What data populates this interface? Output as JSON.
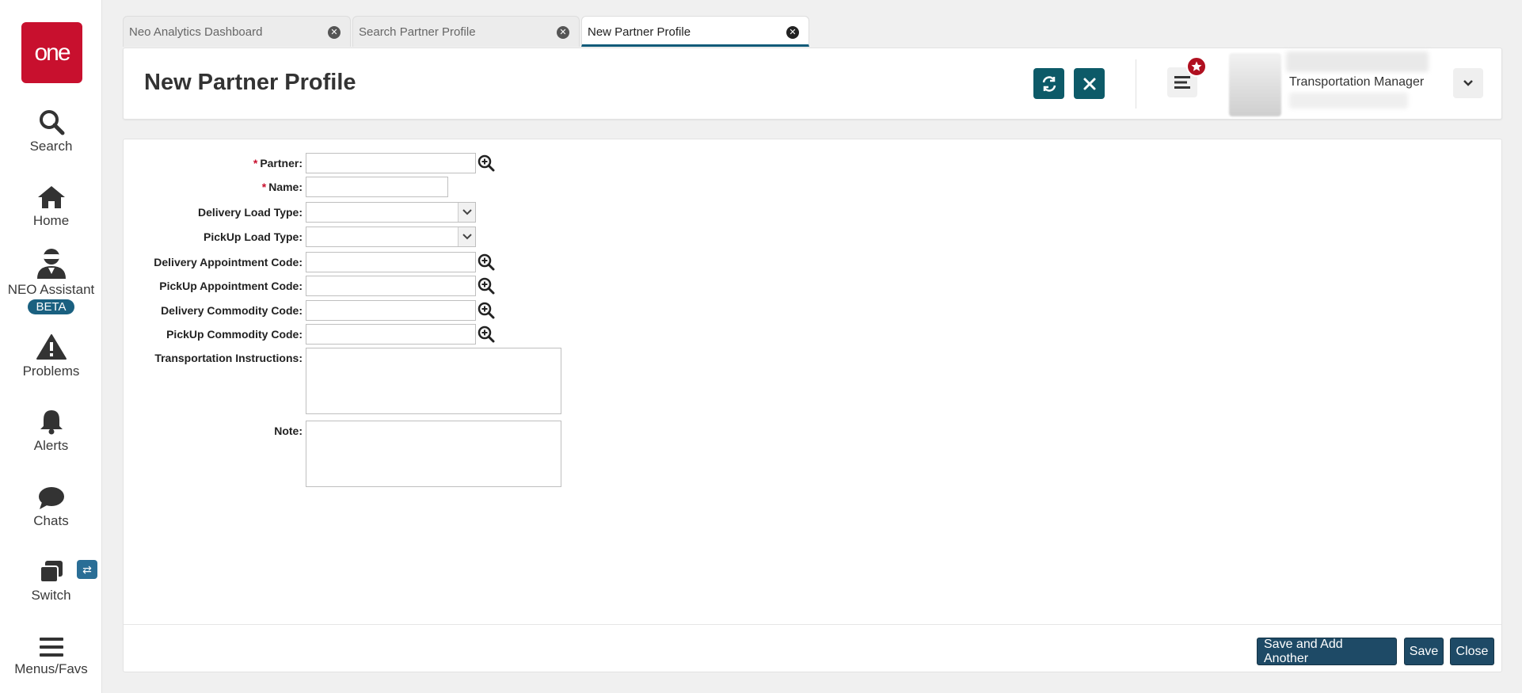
{
  "nav": {
    "logo_text": "one",
    "items": [
      {
        "key": "search",
        "label": "Search",
        "icon": "search-icon"
      },
      {
        "key": "home",
        "label": "Home",
        "icon": "home-icon"
      },
      {
        "key": "neo",
        "label": "NEO Assistant",
        "badge": "BETA",
        "icon": "neo-assistant-icon"
      },
      {
        "key": "problems",
        "label": "Problems",
        "icon": "warning-icon"
      },
      {
        "key": "alerts",
        "label": "Alerts",
        "icon": "bell-icon"
      },
      {
        "key": "chats",
        "label": "Chats",
        "icon": "chat-bubble-icon"
      },
      {
        "key": "switch",
        "label": "Switch",
        "icon": "switch-icon"
      },
      {
        "key": "menus",
        "label": "Menus/Favs",
        "icon": "hamburger-icon"
      }
    ]
  },
  "tabs": [
    {
      "label": "Neo Analytics Dashboard",
      "active": false
    },
    {
      "label": "Search Partner Profile",
      "active": false
    },
    {
      "label": "New Partner Profile",
      "active": true
    }
  ],
  "header": {
    "title": "New Partner Profile",
    "user_role": "Transportation Manager"
  },
  "form": {
    "partner": {
      "label": "Partner:",
      "required": true,
      "value": ""
    },
    "name": {
      "label": "Name:",
      "required": true,
      "value": ""
    },
    "delivery_load_type": {
      "label": "Delivery Load Type:",
      "value": ""
    },
    "pickup_load_type": {
      "label": "PickUp Load Type:",
      "value": ""
    },
    "delivery_appointment_code": {
      "label": "Delivery Appointment Code:",
      "value": ""
    },
    "pickup_appointment_code": {
      "label": "PickUp Appointment Code:",
      "value": ""
    },
    "delivery_commodity_code": {
      "label": "Delivery Commodity Code:",
      "value": ""
    },
    "pickup_commodity_code": {
      "label": "PickUp Commodity Code:",
      "value": ""
    },
    "transportation_instructions": {
      "label": "Transportation Instructions:",
      "value": ""
    },
    "note": {
      "label": "Note:",
      "value": ""
    }
  },
  "footer": {
    "save_and_add_label": "Save and Add Another",
    "save_label": "Save",
    "close_label": "Close"
  },
  "colors": {
    "brand_red": "#c8102e",
    "header_button": "#0d5a68",
    "footer_button": "#1e4a66",
    "beta_badge": "#1a6080"
  }
}
